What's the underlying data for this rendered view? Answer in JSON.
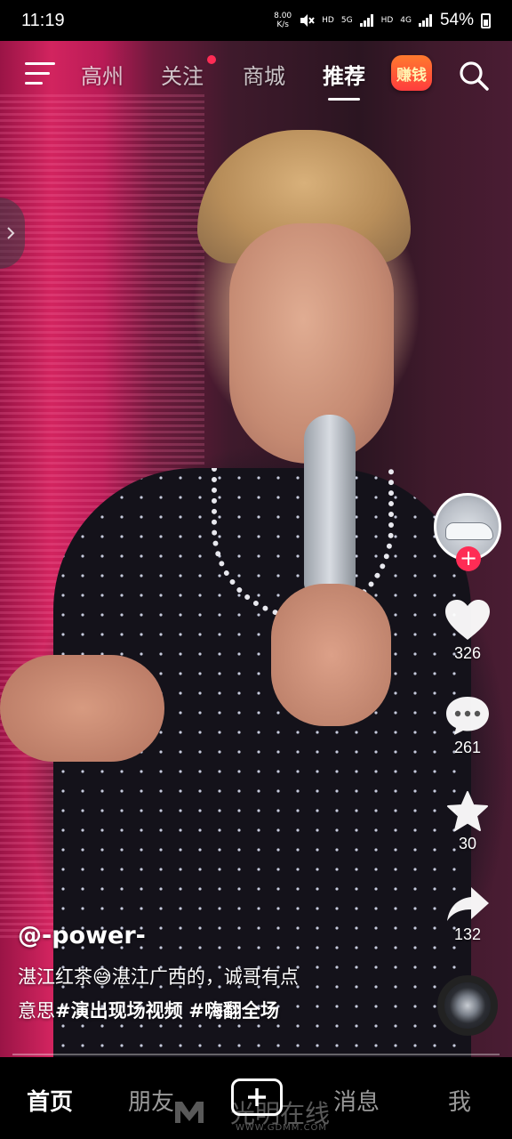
{
  "status_bar": {
    "time": "11:19",
    "net_speed_value": "8.00",
    "net_speed_unit": "K/s",
    "hd1": "HD",
    "net1": "5G",
    "hd2": "HD",
    "net2": "4G",
    "battery": "54%"
  },
  "top_nav": {
    "tabs": [
      "高州",
      "关注",
      "商城",
      "推荐"
    ],
    "active_tab": "推荐",
    "earn_badge": "赚钱"
  },
  "video": {
    "author": "@-power-",
    "desc_line1": "湛江红茶😅湛江广西的，诚哥有点",
    "desc_line2": "意思",
    "hashtag1": "#演出现场视频",
    "hashtag2": "#嗨翻全场"
  },
  "rail": {
    "likes": "326",
    "comments": "261",
    "favorites": "30",
    "shares": "132"
  },
  "bottom_nav": {
    "home": "首页",
    "friends": "朋友",
    "messages": "消息",
    "me": "我",
    "active": "首页"
  },
  "watermark": {
    "main": "光明在线",
    "sub": "WWW.GDMM.COM"
  },
  "colors": {
    "accent": "#fe2c55"
  }
}
